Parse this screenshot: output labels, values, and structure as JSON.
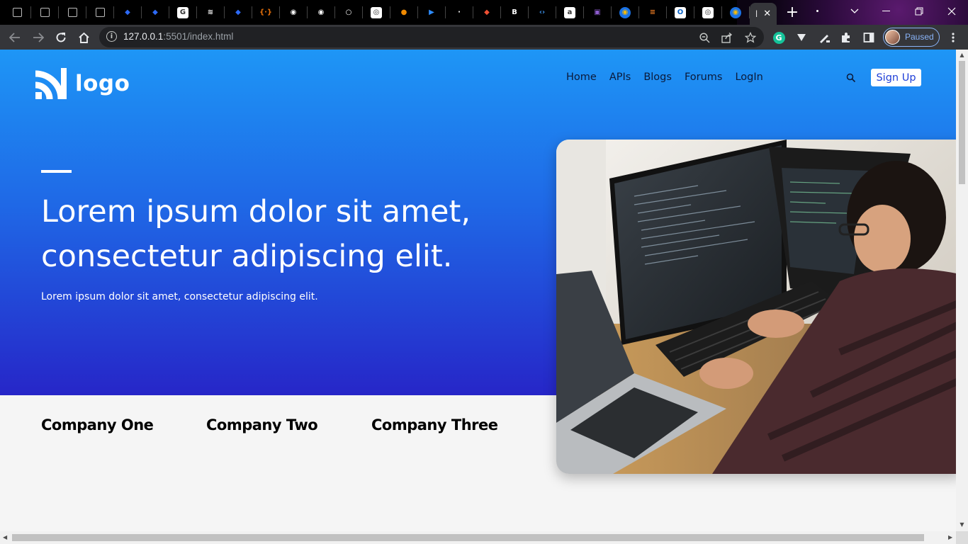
{
  "browser": {
    "tabs": [
      {
        "icon": "blank-square-icon"
      },
      {
        "icon": "blank-square-icon"
      },
      {
        "icon": "blank-square-icon"
      },
      {
        "icon": "blank-square-icon"
      },
      {
        "icon": "jira-icon",
        "color": "#2d6af6"
      },
      {
        "icon": "jira-icon",
        "color": "#2d6af6"
      },
      {
        "icon": "google-icon"
      },
      {
        "icon": "layers-icon"
      },
      {
        "icon": "jira-icon",
        "color": "#2d6af6"
      },
      {
        "icon": "json-icon",
        "color": "#e8710a"
      },
      {
        "icon": "globe-icon"
      },
      {
        "icon": "globe-icon"
      },
      {
        "icon": "github-icon"
      },
      {
        "icon": "vision-icon"
      },
      {
        "icon": "orange-circle-icon",
        "color": "#f08a00"
      },
      {
        "icon": "zoom-icon",
        "color": "#2d8cff"
      },
      {
        "icon": "dark-icon"
      },
      {
        "icon": "git-icon",
        "color": "#f05033"
      },
      {
        "icon": "bitbucket-icon"
      },
      {
        "icon": "code-icon",
        "color": "#3c8fe8"
      },
      {
        "icon": "amazon-icon"
      },
      {
        "icon": "purple-icon",
        "color": "#8e5ccf"
      },
      {
        "icon": "chrome-yellow-icon"
      },
      {
        "icon": "stackoverflow-icon",
        "color": "#f48024"
      },
      {
        "icon": "outlook-icon",
        "color": "#0a64c8"
      },
      {
        "icon": "vision-icon"
      },
      {
        "icon": "chrome-yellow-icon"
      }
    ],
    "active_tab_label": "l",
    "active_tab_close": "✕",
    "new_tab": "+",
    "url_host": "127.0.0.1",
    "url_rest": ":5501/index.html",
    "profile_status": "Paused",
    "colors": {
      "accent": "#8ab4f8",
      "frame": "#35363a"
    }
  },
  "site": {
    "logo_text": "logo",
    "nav": [
      "Home",
      "APIs",
      "Blogs",
      "Forums",
      "LogIn"
    ],
    "signup_label": "Sign Up",
    "headline_line1": "Lorem ipsum dolor sit amet,",
    "headline_line2": "consectetur adipiscing elit.",
    "subline": "Lorem ipsum dolor sit amet, consectetur adipiscing elit.",
    "companies": [
      "Company One",
      "Company Two",
      "Company Three"
    ],
    "hero_image": "programmer-at-computers-photo",
    "colors": {
      "gradient_top": "#1e96f6",
      "gradient_bottom": "#2626c8",
      "signup_text": "#1f3fd8"
    }
  }
}
